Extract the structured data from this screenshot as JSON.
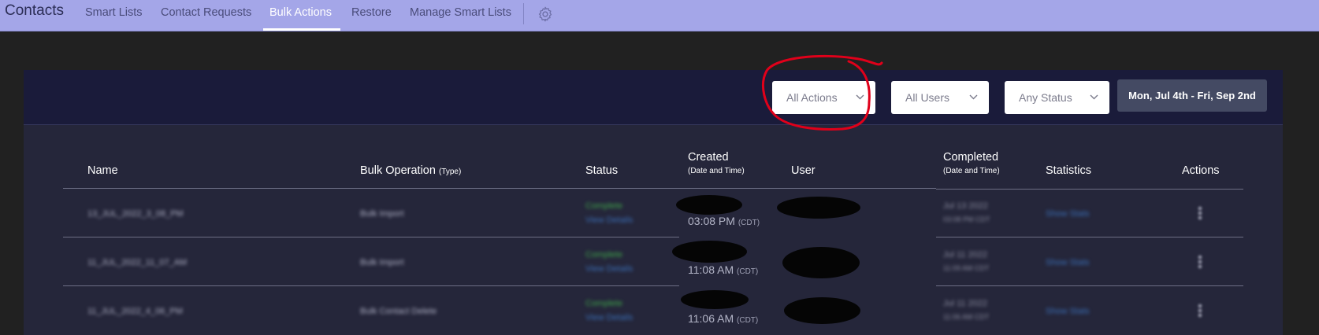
{
  "nav": {
    "title": "Contacts",
    "items": [
      {
        "label": "Smart Lists",
        "active": false
      },
      {
        "label": "Contact Requests",
        "active": false
      },
      {
        "label": "Bulk Actions",
        "active": true
      },
      {
        "label": "Restore",
        "active": false
      },
      {
        "label": "Manage Smart Lists",
        "active": false
      }
    ],
    "settings_icon": "gear-icon"
  },
  "filters": {
    "actions": "All Actions",
    "users": "All Users",
    "status": "Any Status",
    "date_range": "Mon, Jul 4th - Fri, Sep 2nd"
  },
  "table": {
    "headers": {
      "name": "Name",
      "operation": "Bulk Operation",
      "operation_sub": "(Type)",
      "status": "Status",
      "created": "Created",
      "created_sub": "(Date and Time)",
      "user": "User",
      "completed": "Completed",
      "completed_sub": "(Date and Time)",
      "statistics": "Statistics",
      "actions": "Actions"
    },
    "rows": [
      {
        "name": "13_JUL_2022_3_08_PM",
        "operation": "Bulk Import",
        "status": "Complete",
        "details": "View Details",
        "created_time": "03:08 PM",
        "tz": "(CDT)",
        "completed_date": "Jul 13 2022",
        "completed_time": "03:08 PM CDT",
        "stats": "Show Stats"
      },
      {
        "name": "11_JUL_2022_11_07_AM",
        "operation": "Bulk Import",
        "status": "Complete",
        "details": "View Details",
        "created_time": "11:08 AM",
        "tz": "(CDT)",
        "completed_date": "Jul 11 2022",
        "completed_time": "11:09 AM CDT",
        "stats": "Show Stats"
      },
      {
        "name": "11_JUL_2022_4_06_PM",
        "operation": "Bulk Contact Delete",
        "status": "Complete",
        "details": "View Details",
        "created_time": "11:06 AM",
        "tz": "(CDT)",
        "completed_date": "Jul 11 2022",
        "completed_time": "11:06 AM CDT",
        "stats": "Show Stats"
      }
    ]
  },
  "colors": {
    "nav_bg": "#a4a6e8",
    "panel_head": "#1a1b3a",
    "panel_body": "#25263a",
    "annotation": "#e0001a"
  }
}
